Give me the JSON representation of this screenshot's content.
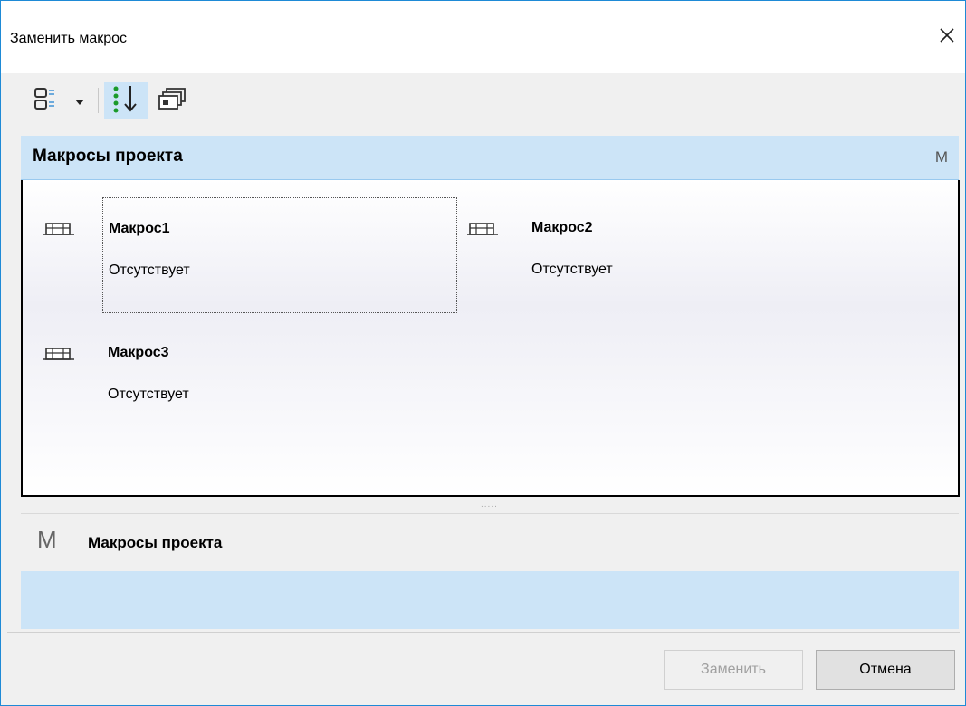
{
  "window": {
    "title": "Заменить макрос",
    "close_glyph": "✕"
  },
  "toolbar": {
    "view_icon": "view-mode-icon",
    "sort_icon": "sort-icon",
    "groups_icon": "groups-icon"
  },
  "group": {
    "title": "Макросы проекта",
    "letter": "M"
  },
  "items": [
    {
      "name": "Макрос1",
      "status": "Отсутствует",
      "icon": "macro-icon",
      "selected": true
    },
    {
      "name": "Макрос2",
      "status": "Отсутствует",
      "icon": "macro-icon",
      "selected": false
    },
    {
      "name": "Макрос3",
      "status": "Отсутствует",
      "icon": "macro-icon",
      "selected": false
    }
  ],
  "splitter": {
    "dots": "....."
  },
  "details": {
    "letter": "M",
    "title": "Макросы проекта"
  },
  "buttons": {
    "replace": "Заменить",
    "cancel": "Отмена"
  },
  "colors": {
    "accent_border": "#1e8ad6",
    "selection_band": "#cce4f7",
    "disabled_text": "#a0a0a0"
  }
}
